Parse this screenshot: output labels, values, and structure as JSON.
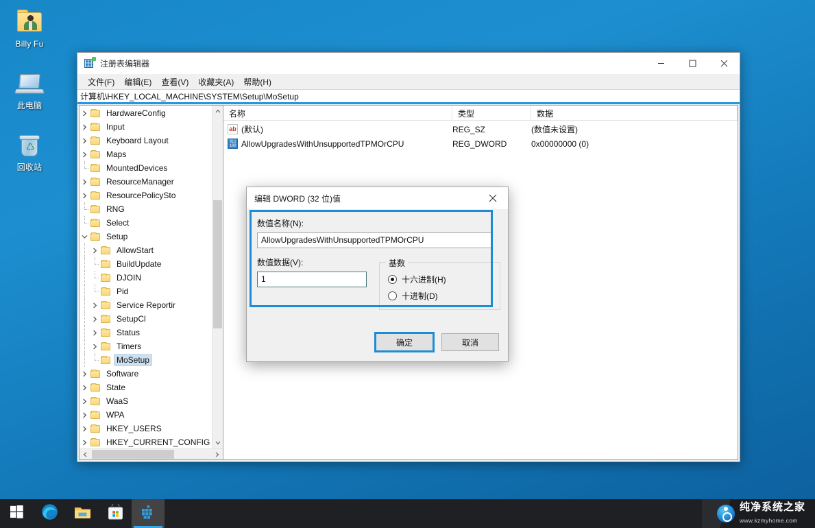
{
  "desktop": {
    "icons": [
      {
        "name": "Billy Fu",
        "icon": "user-folder-icon"
      },
      {
        "name": "此电脑",
        "icon": "this-pc-icon"
      },
      {
        "name": "回收站",
        "icon": "recycle-bin-icon"
      }
    ]
  },
  "window": {
    "title": "注册表编辑器",
    "icon": "registry-editor-icon",
    "controls": {
      "minimize": "最小化",
      "maximize": "最大化",
      "close": "关闭"
    },
    "menus": [
      {
        "label": "文件(F)"
      },
      {
        "label": "编辑(E)"
      },
      {
        "label": "查看(V)"
      },
      {
        "label": "收藏夹(A)"
      },
      {
        "label": "帮助(H)"
      }
    ],
    "address": "计算机\\HKEY_LOCAL_MACHINE\\SYSTEM\\Setup\\MoSetup"
  },
  "tree": {
    "items": [
      {
        "label": "HardwareConfig",
        "indent": 1,
        "expander": "collapsed",
        "selected": false
      },
      {
        "label": "Input",
        "indent": 1,
        "expander": "collapsed",
        "selected": false
      },
      {
        "label": "Keyboard Layout",
        "indent": 1,
        "expander": "collapsed",
        "selected": false
      },
      {
        "label": "Maps",
        "indent": 1,
        "expander": "collapsed",
        "selected": false
      },
      {
        "label": "MountedDevices",
        "indent": 1,
        "expander": "none",
        "selected": false
      },
      {
        "label": "ResourceManager",
        "indent": 1,
        "expander": "collapsed",
        "selected": false
      },
      {
        "label": "ResourcePolicySto",
        "indent": 1,
        "expander": "collapsed",
        "selected": false
      },
      {
        "label": "RNG",
        "indent": 1,
        "expander": "none",
        "selected": false
      },
      {
        "label": "Select",
        "indent": 1,
        "expander": "none",
        "selected": false
      },
      {
        "label": "Setup",
        "indent": 1,
        "expander": "expanded",
        "selected": false
      },
      {
        "label": "AllowStart",
        "indent": 2,
        "expander": "collapsed",
        "selected": false
      },
      {
        "label": "BuildUpdate",
        "indent": 2,
        "expander": "none",
        "selected": false
      },
      {
        "label": "DJOIN",
        "indent": 2,
        "expander": "none",
        "selected": false
      },
      {
        "label": "Pid",
        "indent": 2,
        "expander": "none",
        "selected": false
      },
      {
        "label": "Service Reportir",
        "indent": 2,
        "expander": "collapsed",
        "selected": false
      },
      {
        "label": "SetupCl",
        "indent": 2,
        "expander": "collapsed",
        "selected": false
      },
      {
        "label": "Status",
        "indent": 2,
        "expander": "collapsed",
        "selected": false
      },
      {
        "label": "Timers",
        "indent": 2,
        "expander": "collapsed",
        "selected": false
      },
      {
        "label": "MoSetup",
        "indent": 2,
        "expander": "none",
        "selected": true
      },
      {
        "label": "Software",
        "indent": 1,
        "expander": "collapsed",
        "selected": false
      },
      {
        "label": "State",
        "indent": 1,
        "expander": "collapsed",
        "selected": false
      },
      {
        "label": "WaaS",
        "indent": 1,
        "expander": "collapsed",
        "selected": false
      },
      {
        "label": "WPA",
        "indent": 1,
        "expander": "collapsed",
        "selected": false
      },
      {
        "label": "HKEY_USERS",
        "indent": 0,
        "expander": "collapsed",
        "selected": false
      },
      {
        "label": "HKEY_CURRENT_CONFIG",
        "indent": 0,
        "expander": "collapsed",
        "selected": false
      }
    ]
  },
  "values": {
    "columns": {
      "name": "名称",
      "type": "类型",
      "data": "数据"
    },
    "rows": [
      {
        "icon": "string-value-icon",
        "name": "(默认)",
        "type": "REG_SZ",
        "data": "(数值未设置)"
      },
      {
        "icon": "dword-value-icon",
        "name": "AllowUpgradesWithUnsupportedTPMOrCPU",
        "type": "REG_DWORD",
        "data": "0x00000000 (0)"
      }
    ]
  },
  "dialog": {
    "title": "编辑 DWORD (32 位)值",
    "close_label": "关闭",
    "name_label": "数值名称(N):",
    "name_value": "AllowUpgradesWithUnsupportedTPMOrCPU",
    "data_label": "数值数据(V):",
    "data_value": "1",
    "base_caption": "基数",
    "base_options": [
      {
        "label": "十六进制(H)",
        "selected": true
      },
      {
        "label": "十进制(D)",
        "selected": false
      }
    ],
    "ok_label": "确定",
    "cancel_label": "取消"
  },
  "taskbar": {
    "buttons": [
      {
        "name": "start-button",
        "icon": "windows-logo-icon",
        "active": false
      },
      {
        "name": "edge-button",
        "icon": "edge-icon",
        "active": false
      },
      {
        "name": "file-explorer-button",
        "icon": "folder-icon",
        "active": false
      },
      {
        "name": "microsoft-store-button",
        "icon": "store-icon",
        "active": false
      },
      {
        "name": "registry-editor-button",
        "icon": "registry-editor-icon",
        "active": true
      }
    ]
  },
  "watermark": {
    "brand": "纯净系统之家",
    "url": "www.kzmyhome.com"
  },
  "colors": {
    "accent": "#1a8cd8",
    "taskbar": "#1f2023",
    "selection": "#cde0ef",
    "folder": "#f9d877"
  }
}
